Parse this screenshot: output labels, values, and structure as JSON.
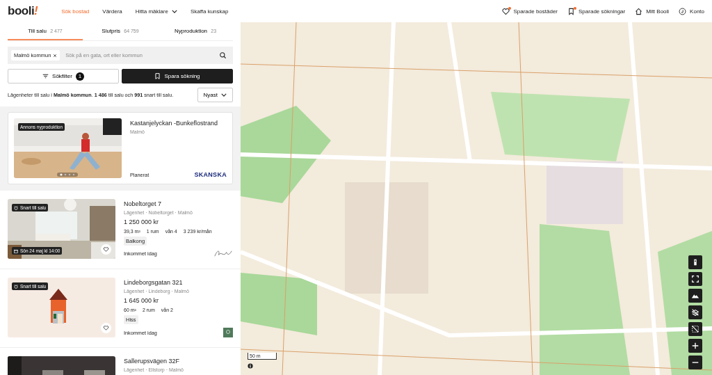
{
  "header": {
    "logo": "booli",
    "logo_mark": "!",
    "nav": [
      {
        "label": "Sök bostad",
        "selected": true,
        "caret": false
      },
      {
        "label": "Värdera",
        "selected": false,
        "caret": false
      },
      {
        "label": "Hitta mäklare",
        "selected": false,
        "caret": true
      },
      {
        "label": "Skaffa kunskap",
        "selected": false,
        "caret": false
      }
    ],
    "actions": [
      {
        "kind": "heart",
        "label": "Sparade bostäder",
        "dot": true
      },
      {
        "kind": "bookmark",
        "label": "Sparade sökningar",
        "dot": true
      },
      {
        "kind": "home",
        "label": "Mitt Booli",
        "dot": false
      },
      {
        "kind": "account",
        "label": "Konto",
        "dot": false
      }
    ]
  },
  "tabs": [
    {
      "label": "Till salu",
      "count": "2 477",
      "selected": true
    },
    {
      "label": "Slutpris",
      "count": "64 759",
      "selected": false
    },
    {
      "label": "Nyproduktion",
      "count": "23",
      "selected": false
    }
  ],
  "search": {
    "chip": "Malmö kommun",
    "placeholder": "Sök på en gata, ort eller kommun"
  },
  "filter_button": {
    "label": "Sökfilter",
    "badge": "1"
  },
  "save_button": {
    "label": "Spara sökning"
  },
  "summary": "Lägenheter till salu i **Malmö kommun**. **1 486** till salu och **991** snart till salu.",
  "sort": "Nyast",
  "listings": [
    {
      "kind": "ad",
      "badge": "Annons nyproduktion",
      "title": "Kastanjelyckan -Bunkeflostrand",
      "subtitle": "Malmö",
      "status": "Planerat",
      "brand": "SKANSKA"
    },
    {
      "kind": "listing",
      "badge": "Snart till salu",
      "viewing": "Sön 24 maj kl 14:00",
      "title": "Nobeltorget 7",
      "subtitle": "Lägenhet · Nobeltorget · Malmö",
      "price": "1 250 000 kr",
      "facts": [
        "39,3 m²",
        "1 rum",
        "vån 4",
        "3 239 kr/mån"
      ],
      "tags": [
        "Balkong"
      ],
      "status": "Inkommet idag"
    },
    {
      "kind": "listing",
      "badge": "Snart till salu",
      "title": "Lindeborgsgatan 321",
      "subtitle": "Lägenhet · Lindeborg · Malmö",
      "price": "1 645 000 kr",
      "facts": [
        "60 m²",
        "2 rum",
        "vån 2"
      ],
      "tags": [
        "Hiss"
      ],
      "status": "Inkommet idag"
    },
    {
      "kind": "listing",
      "title": "Sallerupsvägen 32F",
      "subtitle": "Lägenhet · Ellstorp · Malmö"
    }
  ],
  "map": {
    "scale": "50 m"
  }
}
